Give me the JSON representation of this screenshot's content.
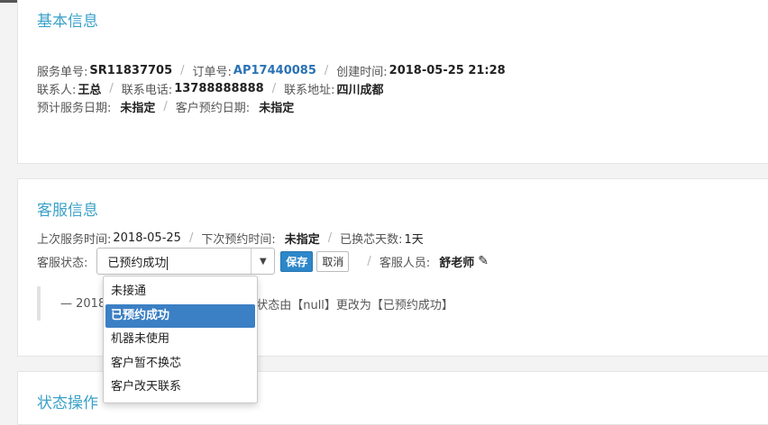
{
  "basic_info": {
    "title": "基本信息",
    "service_no_label": "服务单号:",
    "service_no": "SR11837705",
    "order_no_label": "订单号:",
    "order_no": "AP17440085",
    "created_label": "创建时间:",
    "created": "2018-05-25 21:28",
    "contact_label": "联系人:",
    "contact": "王总",
    "phone_label": "联系电话:",
    "phone": "13788888888",
    "address_label": "联系地址:",
    "address": "四川成都",
    "planned_date_label": "预计服务日期:",
    "planned_date": "未指定",
    "customer_date_label": "客户预约日期:",
    "customer_date": "未指定"
  },
  "cs_info": {
    "title": "客服信息",
    "last_service_label": "上次服务时间:",
    "last_service": "2018-05-25",
    "next_appt_label": "下次预约时间:",
    "next_appt": "未指定",
    "days_label": "已换芯天数:",
    "days": "1天",
    "status_label": "客服状态:",
    "status_value": "已预约成功",
    "save_label": "保存",
    "cancel_label": "取消",
    "staff_label": "客服人员:",
    "staff": "舒老师",
    "log_prefix": "— 2018",
    "log_suffix": "师，将状态由【null】更改为【已预约成功】"
  },
  "dropdown": {
    "options": [
      "未接通",
      "已预约成功",
      "机器未使用",
      "客户暂不换芯",
      "客户改天联系"
    ],
    "selected_index": 1
  },
  "status_ops": {
    "title": "状态操作"
  }
}
